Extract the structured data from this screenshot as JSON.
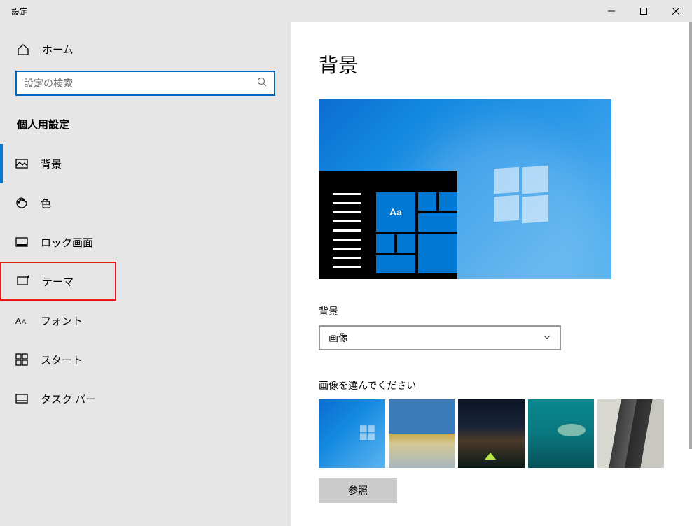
{
  "window": {
    "title": "設定"
  },
  "sidebar": {
    "home_label": "ホーム",
    "search_placeholder": "設定の検索",
    "section_header": "個人用設定",
    "items": [
      {
        "label": "背景"
      },
      {
        "label": "色"
      },
      {
        "label": "ロック画面"
      },
      {
        "label": "テーマ"
      },
      {
        "label": "フォント"
      },
      {
        "label": "スタート"
      },
      {
        "label": "タスク バー"
      }
    ]
  },
  "content": {
    "page_title": "背景",
    "preview_sample_text": "Aa",
    "bg_label": "背景",
    "bg_dropdown_value": "画像",
    "choose_image_label": "画像を選んでください",
    "browse_label": "参照"
  }
}
